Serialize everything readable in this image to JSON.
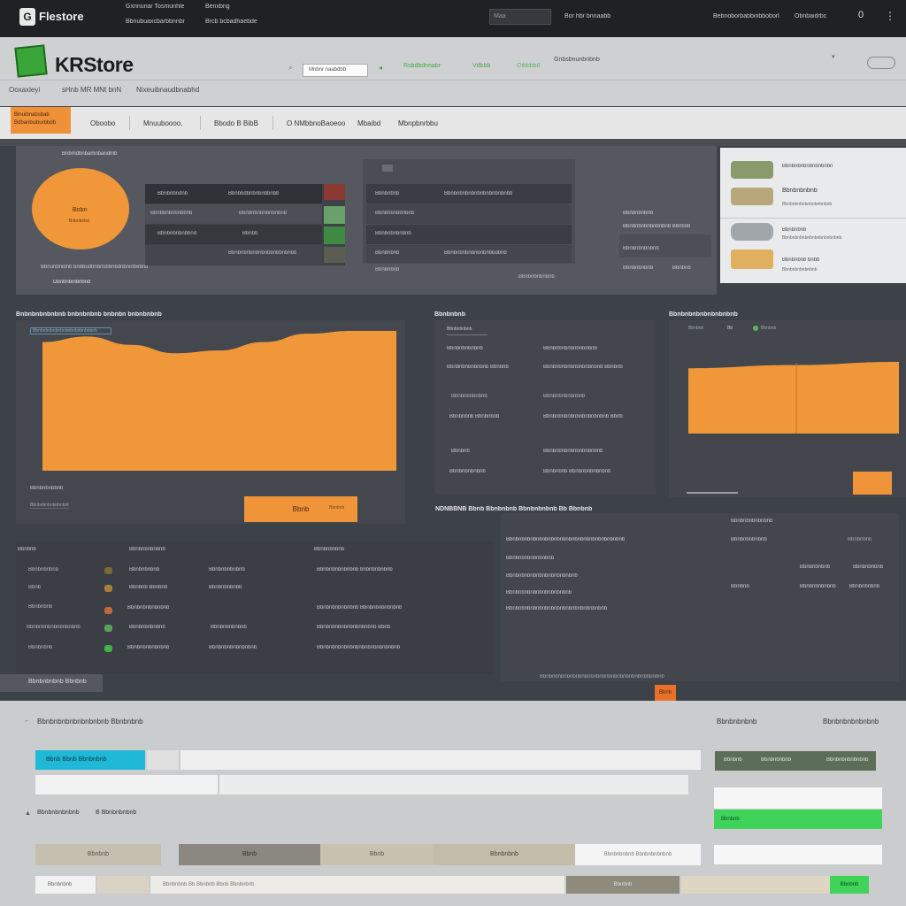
{
  "topbar": {
    "logo_icon": "store-logo-icon",
    "brand": "Flestore",
    "links_row1": [
      "Gxnnunar Tosmunhle",
      "Benxbng"
    ],
    "links_row2": [
      "Bbnubuaxcbarbbnnbr",
      "Brcb   bcbadhaebde"
    ],
    "search_placeholder": "Maa",
    "center_link": "Bor  hbr   bnnaabb",
    "right_links": [
      "Bebnoborbabbinbboborl",
      "Obnbaidrbc"
    ],
    "counter": "0",
    "menu_icon": "vertical-dots-icon"
  },
  "header": {
    "brand": "KRStore",
    "search_placeholder": "Mnbnr naabdbb",
    "green_links": [
      "Rsbdbdnnabr",
      "Vdbbb",
      "Oibbbbd"
    ],
    "right_link": "Gnbsbnunbnbnb",
    "sub_links": [
      "Ooxaxieyi",
      "sHnb  MR MNt  bnN",
      "Nixeuibnaudbnabhd"
    ],
    "cart_icon": "cart-icon"
  },
  "nav": {
    "promo_button": [
      "Blnuibnabsbab",
      "Bdbanbsiburbbdb"
    ],
    "items": [
      "Oboobo",
      "Mnuuboooo.",
      "Bbodo  B BibB",
      "O NMbbnoBaoeoo",
      "Mbaibd",
      "Mbnpbnrbbu"
    ]
  },
  "hero": {
    "top_label": "Bnbmdbnbamnbandmb",
    "circle_label": "Bnbn",
    "circle_sub": "Bnbnbnbd",
    "under_circle": "Bbnunbnibnb bnbbudbnbnsbbnbdnbninbebnb",
    "under_circle2": "Dbnbnbinbnbnd",
    "table1": [
      [
        "Bbnbnbndnb",
        "Bbnbbdbnbnbnbbnbb"
      ],
      [
        "Bbnbbnbnbnbbnb",
        "Bbnbnbnbnbnbnbnb"
      ],
      [
        "Bbnbnbnbnbbnd",
        "Bbnbb"
      ],
      [
        "",
        "Bbnbnbnbnbnbnbbnbbnbnbb"
      ]
    ],
    "table2": [
      [
        "Bbnbnbnb",
        "Bbnbnbnbnbnbnbnbnbnbnbb"
      ],
      [
        "Bbnbnbnbbnbnb",
        ""
      ],
      [
        "Bbnbnbnbnbnb",
        ""
      ],
      [
        "Bbnbnbnb",
        "Bbnbnbnbnbnbnbnbbdbnb"
      ],
      [
        "Bbnbnbnb",
        "Bbnbnbnbnbnb"
      ]
    ],
    "right_col": [
      "Bbnbnbnbnb",
      "Bbnbnbnbnbnbnbnb   Bbnbnb",
      "Bbnbnbnbnbnb",
      "Bbnbnbnbnb",
      "Bbnbnb"
    ]
  },
  "promo": {
    "items": [
      {
        "title": "Bbnbnbnbnbnbnbnbn",
        "sub": "",
        "icon": "wrench-icon"
      },
      {
        "title": "Bbnbnbnbnb",
        "sub": "Bbnbnbnbnbnbnbnbnbnb",
        "icon": "drill-icon"
      },
      {
        "title": "Bbnbnbnb",
        "sub": "Bbnbnbnbnbnbnbnbnbnbnbnb",
        "icon": "car-icon"
      },
      {
        "title": "Bbnbnbnb  bnbb",
        "sub": "Bbnbnbnbnbnbnb",
        "icon": "tool-icon"
      }
    ]
  },
  "chart1": {
    "title": "Bnbnbnbnbnbnb bnbnbnbnb bnbnbn bnbnbnbnb",
    "legend": "Bbnbnbnbnbnbnbnbnbnbnbnbnb",
    "footer": [
      "Bbnbnbnbbnb",
      "Bbnbnbnbnbnbnbnb"
    ],
    "button": "Bbnb",
    "button_note": "Bbnbnb"
  },
  "chart_data": [
    {
      "type": "area",
      "title": "Bnbnbnbnbnbnb bnbnbnbnb bnbnbn bnbnbnbnb",
      "x": [
        0,
        1,
        2,
        3,
        4,
        5,
        6,
        7,
        8
      ],
      "values": [
        92,
        96,
        90,
        84,
        86,
        92,
        98,
        100,
        100
      ],
      "ylim": [
        0,
        100
      ],
      "color": "#f0973a",
      "grid": false
    },
    {
      "type": "area",
      "title": "Bbnbnbnbnbnbnbnbnb",
      "x": [
        0,
        1,
        2
      ],
      "values": [
        82,
        86,
        90
      ],
      "ylim": [
        0,
        100
      ],
      "color": "#f0973a",
      "grid": false
    }
  ],
  "mid_list": {
    "title": "Bbnbnbnb",
    "tag": "Bbnbnbnbnb",
    "rows": [
      [
        "Bbnbnbnbnbnb",
        "Bbnbnbnbnbnbnbnbnb"
      ],
      [
        "Bbnbnbnbnbnbnb  Bbnbnb",
        "Bbnbnbnbnbnbnbnbnbnb  Bbnbnb"
      ],
      [
        "Bbnbnbnbnbnb",
        "Bbnbnbnbnbnbnb"
      ],
      [
        "Bbnbnbnb  Bbnbnbnb",
        "Bbnbnbnbnbnbnbnbnbnbnb  Bbnb"
      ],
      [
        "Bbnbnb",
        "Bbnbnbnbnbnbnbnbnbnb"
      ],
      [
        "Bbnbnbnbnbnb",
        "Bbnbnbnb  Bbnbnbnbnbnbnb"
      ]
    ]
  },
  "chart2": {
    "title": "Bbnbnbnbnbnbnbnbnb",
    "legend": [
      "Bbnbnb",
      "Bb",
      "Bbnbnb"
    ]
  },
  "table_section": {
    "title": "NDNBBNB Bbnb Bbnbnbnb Bbnbnbnbnb Bb Bbnbnb",
    "left_header": [
      "Bbnbnb",
      "Bbnbnbnbnbnb",
      "Bbnbnbnbnb"
    ],
    "left_rows": [
      [
        "Bbnbnbnbnb",
        "Bbnbnbnbnb",
        "Bbnbnbnbnbnb",
        "Bbnbnbnbnbnbnb  bnbnbnbnbnb",
        "#7a6a3a"
      ],
      [
        "Bbnb",
        "Bbnbnb  Bbnbnb",
        "Bbnbnbnbnbb",
        "",
        "#a8803a"
      ],
      [
        "Bbnbnbnb",
        "Bbnbnbnbnbnbnb",
        "",
        "Bbnbnbnbnbnbnb  Bbnbnbnbnbnbnb",
        "#c06a3a"
      ],
      [
        "Bbnbnbnbnbnbnbnbnb",
        "Bbnbnbnbnbnb",
        "Bbnbnbnbnbnb",
        "Bbnbnbnbnbnbnbnbnbnb  Bbnb",
        "#5aa05a"
      ],
      [
        "Bbnbnbnb",
        "Bbnbnbnbnbnbnb",
        "Bbnbnbnbnbnbnbnb",
        "Bbnbnbnbnbnbnbnbnbnbnbnbnbnb",
        "#3fb34a"
      ]
    ],
    "right_rows": [
      [
        "Bbnbnbnbnbnbnbnbnbnbnbnbnbnbnbnbnbnbnbnb",
        "Bbnbnbnbnbnb",
        "Bbnbnbnb"
      ],
      [
        "Bbnbnbnbnbnbnbnb",
        "",
        ""
      ],
      [
        "Bbnbnbnbnbnbnbnbnbnbnbnb",
        "Bbnbnbnbnb",
        "Bbnbnbnbnb"
      ],
      [
        "Bbnbnbnbnbnbnbnbnbnbnb",
        "Bbnbnb",
        ""
      ],
      [
        "Bbnbnbnbnbnbnbnbnbnbnbnbnbnbnbnbnb",
        "Bbnbnbnbnbnb",
        "Bbnbnbnbnb"
      ]
    ],
    "right_header": "Bbnbnbnbnbnbnb",
    "footer_left": "Bbnbnbnbnb Bbnbnb",
    "footer_mid": "Bbnbnbnbnbnbnbnbnbnbnbnbnbnbnbnbnbnbnbnbnb",
    "badge": "Bbnb"
  },
  "bottom": {
    "title": "Bbnbnbnbnbnbnbnbnb Bbnbnbnb",
    "right_labels": [
      "Bbnbnbnbnb",
      "Bbnbnbnbnbnbnb"
    ],
    "cyan_tab": "Bbnb   Bbnb  Bbnbnbnb",
    "green_bar": [
      "Bbnbnb",
      "Bbnbnbnbnb",
      "Bbnbnbnbnbnbnb"
    ],
    "section2": [
      "Bbnbnbnbnbnb",
      "B  Bbnbnbnbnb"
    ],
    "row2": [
      "Bbnbnb",
      "Bbnb",
      "Bbnb",
      "Bbnbnbnb",
      "Bbnbnbnbnb  Bbnbnbnbnbnb"
    ],
    "green_small": "Bbnbnb",
    "row3": [
      "Bbnbnbnb",
      "Bbnbnbnb Bb Bbnbnb Bbnb Bbnbnbnb",
      "Bbnbnb",
      "Bbnbnb"
    ],
    "colors": {
      "cyan": "#1fb8d6",
      "green": "#3fd35a",
      "dark_green": "#5c6e58",
      "orange": "#f0943a"
    }
  }
}
